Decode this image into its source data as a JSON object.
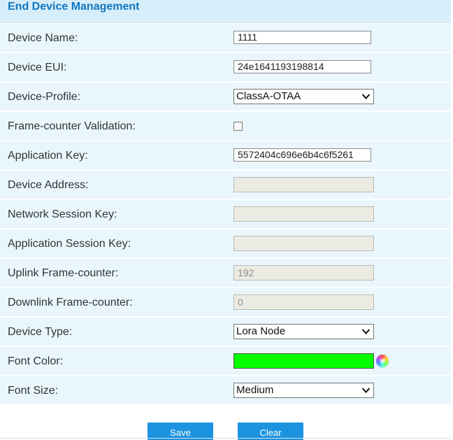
{
  "header": {
    "title": "End Device Management"
  },
  "fields": {
    "device_name": {
      "label": "Device Name:",
      "value": "1111"
    },
    "device_eui": {
      "label": "Device EUI:",
      "value": "24e1641193198814"
    },
    "device_profile": {
      "label": "Device-Profile:",
      "value": "ClassA-OTAA"
    },
    "frame_counter_validation": {
      "label": "Frame-counter Validation:",
      "checked": false
    },
    "application_key": {
      "label": "Application Key:",
      "value": "5572404c696e6b4c6f5261"
    },
    "device_address": {
      "label": "Device Address:",
      "value": ""
    },
    "network_session_key": {
      "label": "Network Session Key:",
      "value": ""
    },
    "application_session_key": {
      "label": "Application Session Key:",
      "value": ""
    },
    "uplink_frame_counter": {
      "label": "Uplink Frame-counter:",
      "value": "192"
    },
    "downlink_frame_counter": {
      "label": "Downlink Frame-counter:",
      "value": "0"
    },
    "device_type": {
      "label": "Device Type:",
      "value": "Lora Node"
    },
    "font_color": {
      "label": "Font Color:",
      "value": "#00ff00"
    },
    "font_size": {
      "label": "Font Size:",
      "value": "Medium"
    }
  },
  "buttons": {
    "save": "Save",
    "clear": "Clear"
  },
  "colors": {
    "header_bg": "#d6eefa",
    "header_text": "#1277c0",
    "row_bg": "#e9f7fd",
    "button_bg": "#1c93e0",
    "disabled_bg": "#ebebe4"
  },
  "icons": {
    "select_arrow": "chevron-down-icon",
    "color_picker": "color-wheel-icon"
  }
}
